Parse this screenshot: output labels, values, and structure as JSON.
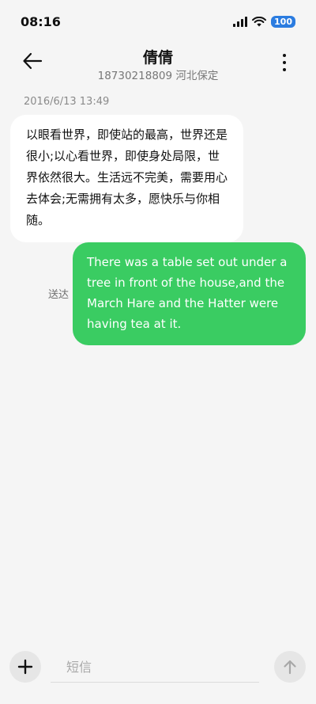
{
  "status_bar": {
    "time": "08:16",
    "battery": "100",
    "icons": [
      "signal-icon",
      "wifi-icon",
      "battery-icon"
    ]
  },
  "header": {
    "contact_name": "倩倩",
    "contact_sub": "18730218809 河北保定",
    "back_icon": "arrow-left-icon",
    "more_icon": "more-vertical-icon"
  },
  "conversation": {
    "timestamp": "2016/6/13 13:49",
    "messages": [
      {
        "direction": "incoming",
        "text": "以眼看世界，即使站的最高，世界还是很小;以心看世界，即使身处局限，世界依然很大。生活远不完美，需要用心去体会;无需拥有太多，愿快乐与你相随。"
      },
      {
        "direction": "outgoing",
        "text": "There was a table set out under a tree in front of the house,and the March Hare and the Hatter were having tea at it.",
        "status": "送达"
      }
    ]
  },
  "input_bar": {
    "placeholder": "短信",
    "value": "",
    "add_icon": "plus-icon",
    "send_icon": "arrow-up-icon"
  },
  "colors": {
    "outgoing_bubble": "#3acc62",
    "incoming_bubble": "#ffffff",
    "background": "#f5f5f5",
    "battery_badge": "#2b7ce0"
  }
}
